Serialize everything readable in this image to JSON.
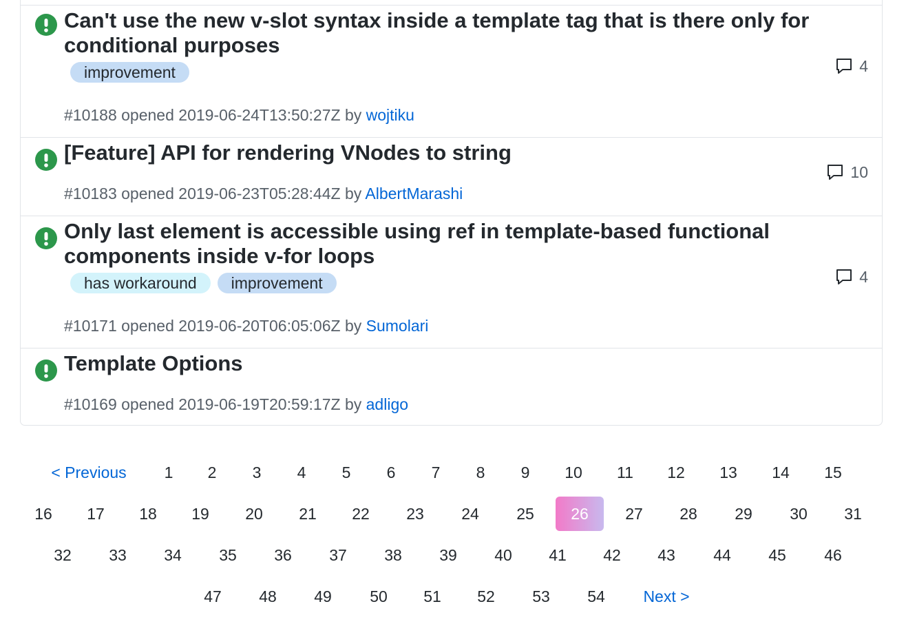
{
  "colors": {
    "open_icon": "#2c974b",
    "link": "#0366d6",
    "label_improvement": "#c5dcf5",
    "label_has_workaround": "#d3f3fb",
    "current_page_gradient": [
      "#f27ac8",
      "#c8b9ee"
    ]
  },
  "issues": [
    {
      "title": "Can't use the new v-slot syntax inside a template tag that is there only for conditional purposes",
      "labels": [
        "improvement"
      ],
      "number": "#10188",
      "opened_text": "opened",
      "date": "2019-06-24T13:50:27Z",
      "by_text": "by",
      "author": "wojtiku",
      "comments": "4",
      "icon": "issue-opened-icon"
    },
    {
      "title": "[Feature] API for rendering VNodes to string",
      "labels": [],
      "number": "#10183",
      "opened_text": "opened",
      "date": "2019-06-23T05:28:44Z",
      "by_text": "by",
      "author": "AlbertMarashi",
      "comments": "10",
      "icon": "issue-opened-icon"
    },
    {
      "title": "Only last element is accessible using ref in template-based functional components inside v-for loops",
      "labels": [
        "has workaround",
        "improvement"
      ],
      "number": "#10171",
      "opened_text": "opened",
      "date": "2019-06-20T06:05:06Z",
      "by_text": "by",
      "author": "Sumolari",
      "comments": "4",
      "icon": "issue-opened-icon"
    },
    {
      "title": "Template Options",
      "labels": [],
      "number": "#10169",
      "opened_text": "opened",
      "date": "2019-06-19T20:59:17Z",
      "by_text": "by",
      "author": "adligo",
      "comments": "",
      "icon": "issue-opened-icon"
    }
  ],
  "pagination": {
    "previous_label": "< Previous",
    "next_label": "Next >",
    "current": "26",
    "pages": [
      "1",
      "2",
      "3",
      "4",
      "5",
      "6",
      "7",
      "8",
      "9",
      "10",
      "11",
      "12",
      "13",
      "14",
      "15",
      "16",
      "17",
      "18",
      "19",
      "20",
      "21",
      "22",
      "23",
      "24",
      "25",
      "26",
      "27",
      "28",
      "29",
      "30",
      "31",
      "32",
      "33",
      "34",
      "35",
      "36",
      "37",
      "38",
      "39",
      "40",
      "41",
      "42",
      "43",
      "44",
      "45",
      "46",
      "47",
      "48",
      "49",
      "50",
      "51",
      "52",
      "53",
      "54"
    ]
  }
}
